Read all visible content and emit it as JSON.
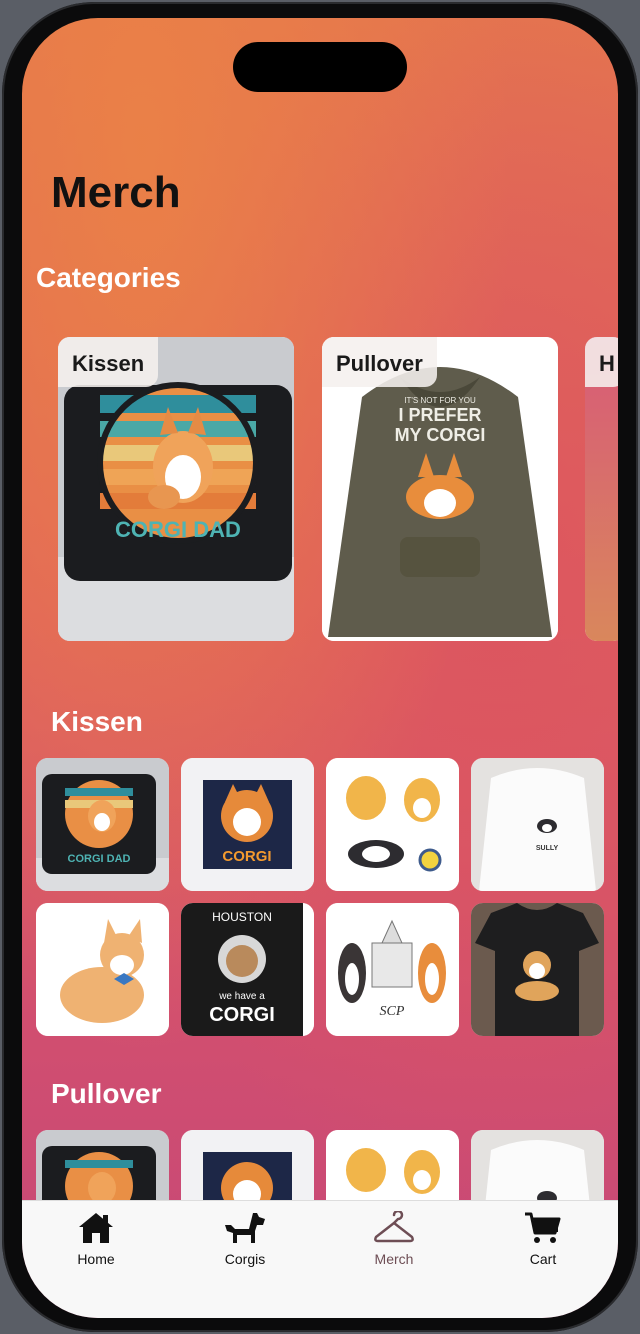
{
  "page": {
    "title": "Merch"
  },
  "sections": {
    "categories": "Categories",
    "kissen": "Kissen",
    "pullover": "Pullover"
  },
  "categories": [
    {
      "label": "Kissen"
    },
    {
      "label": "Pullover"
    },
    {
      "label": "H"
    }
  ],
  "products": {
    "pillow_text": "CORGI DAD",
    "poster_text": "CORGI",
    "shirt_text": "SULLY",
    "houston_top": "HOUSTON",
    "houston_mid": "we have a",
    "houston_bottom": "CORGI",
    "sticker_text": "SCP",
    "hoodie_line1": "IT'S NOT FOR YOU",
    "hoodie_line2": "I PREFER",
    "hoodie_line3": "MY CORGI"
  },
  "tabbar": {
    "home": "Home",
    "corgis": "Corgis",
    "merch": "Merch",
    "cart": "Cart"
  },
  "colors": {
    "active_tab": "#6e4e55"
  }
}
